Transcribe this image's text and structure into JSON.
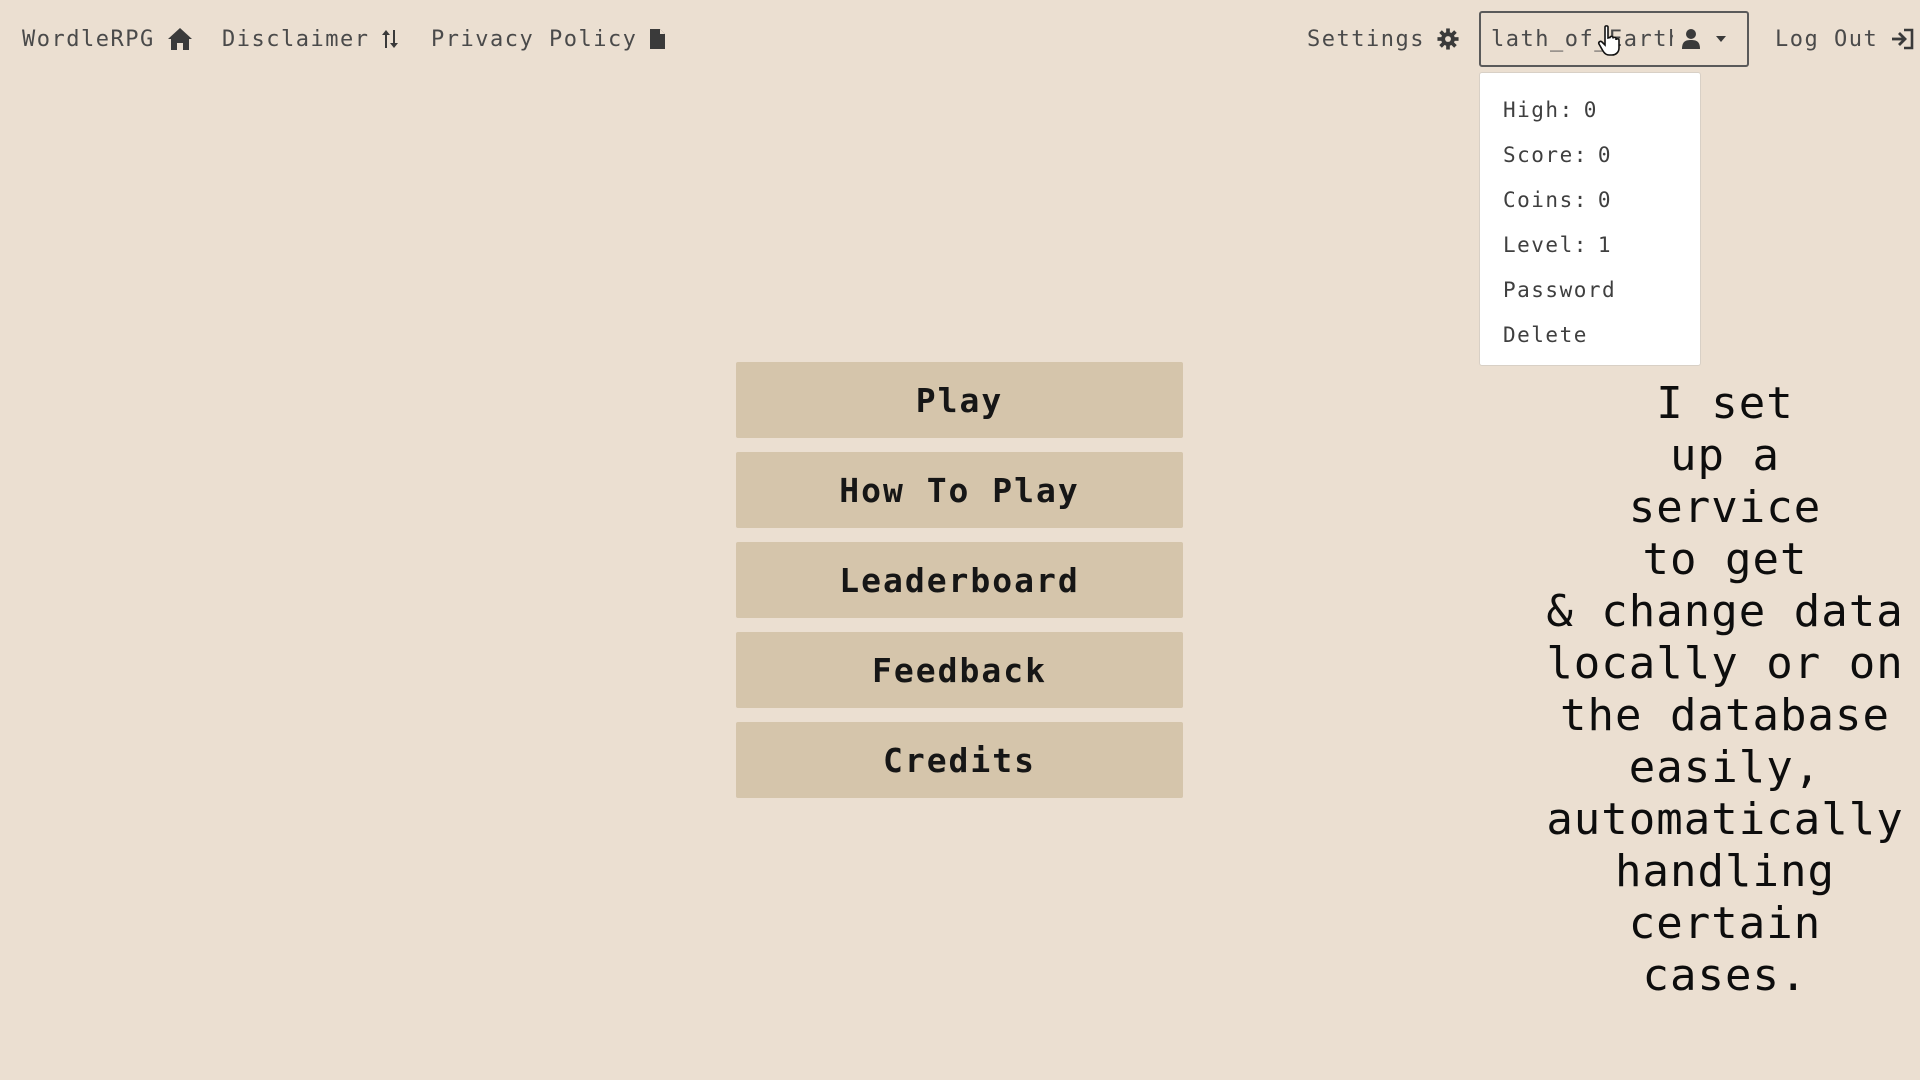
{
  "navbar": {
    "brand": "WordleRPG",
    "disclaimer": "Disclaimer",
    "privacy": "Privacy Policy",
    "settings": "Settings",
    "username": "lath_of_Earth",
    "logout": "Log Out",
    "icons": {
      "brand": "home-icon",
      "disclaimer": "sort-arrows-icon",
      "privacy": "document-icon",
      "settings": "gear-icon",
      "user": "user-icon",
      "caret": "caret-down-icon",
      "logout": "sign-out-icon"
    }
  },
  "user_menu": {
    "high": {
      "label": "High:",
      "value": "0"
    },
    "score": {
      "label": "Score:",
      "value": "0"
    },
    "coins": {
      "label": "Coins:",
      "value": "0"
    },
    "level": {
      "label": "Level:",
      "value": "1"
    },
    "password": "Password",
    "delete": "Delete"
  },
  "main_menu": {
    "play": "Play",
    "how_to_play": "How To Play",
    "leaderboard": "Leaderboard",
    "feedback": "Feedback",
    "credits": "Credits"
  },
  "caption": "I set\nup a\nservice\nto get\n& change data\nlocally or on\nthe database\neasily,\nautomatically\nhandling\ncertain\ncases.",
  "colors": {
    "background": "#ebdfd1",
    "button": "#d5c5ab",
    "dropdown": "#ffffff"
  }
}
